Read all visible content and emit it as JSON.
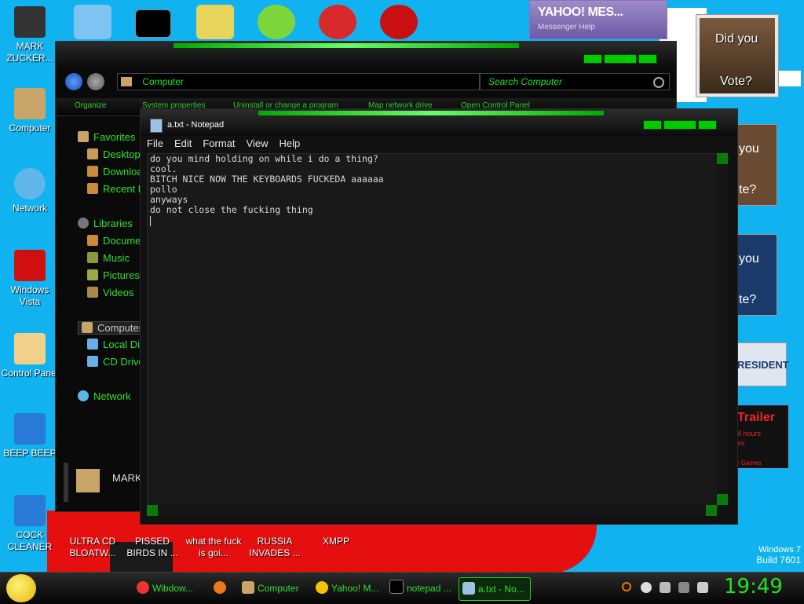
{
  "desktop": {
    "left_icons": [
      {
        "label": "MARK ZUCKER..."
      },
      {
        "label": "Computer"
      },
      {
        "label": "Network"
      },
      {
        "label": "Windows Vista"
      },
      {
        "label": "Control Panel"
      },
      {
        "label": "BEEP BEEP"
      },
      {
        "label": "COCK CLEANER"
      }
    ],
    "bottom_icons": [
      {
        "label": "ULTRA CD BLOATW..."
      },
      {
        "label": "PISSED BIRDS IN ..."
      },
      {
        "label": "what the fuck is goi..."
      },
      {
        "label": "RUSSIA INVADES ..."
      },
      {
        "label": "XMPP"
      }
    ],
    "watermark": {
      "line1": "Windows 7",
      "line2": "Build 7601"
    }
  },
  "yahoo_gadget": {
    "title": "YAHOO! MES...",
    "subtitle": "Messenger   Help"
  },
  "obama_gadget": {
    "text1": "Did you",
    "text2": "Vote?"
  },
  "right_cards": [
    {
      "text1": "you",
      "text2": "te?"
    },
    {
      "text1": "you",
      "text2": "te?"
    },
    {
      "text1": "RESIDENT"
    },
    {
      "text1": "Trailer",
      "text2": "4 hours",
      "text3": "es",
      "text4": "r Games"
    }
  ],
  "explorer": {
    "address": "Computer",
    "search_placeholder": "Search Computer",
    "commands": [
      "Organize",
      "System properties",
      "Uninstall or change a program",
      "Map network drive",
      "Open Control Panel"
    ],
    "nav": {
      "favorites": "Favorites",
      "desktop": "Desktop",
      "downloads": "Downloa",
      "recent": "Recent P",
      "libraries": "Libraries",
      "documents": "Docume",
      "music": "Music",
      "pictures": "Pictures",
      "videos": "Videos",
      "computer": "Computer",
      "local_disk": "Local Di",
      "cd_drive": "CD Drive",
      "network": "Network"
    },
    "details_name": "MARK"
  },
  "notepad": {
    "title": "a.txt - Notepad",
    "menu": [
      "File",
      "Edit",
      "Format",
      "View",
      "Help"
    ],
    "content": "do you mind holding on while i do a thing?\ncool.\nBITCH NICE NOW THE KEYBOARDS FUCKEDA aaaaaa\npollo\nanyways\ndo not close the fucking thing"
  },
  "taskbar": {
    "buttons": [
      {
        "label": "Wibdow..."
      },
      {
        "label": ""
      },
      {
        "label": "Computer"
      },
      {
        "label": "Yahoo! M..."
      },
      {
        "label": "notepad ..."
      },
      {
        "label": "a.txt - No..."
      }
    ],
    "clock": "19:49"
  },
  "colors": {
    "accent": "#2ee02e",
    "desktop_bg": "#10b3f0",
    "bg_red": "#e60f0f"
  }
}
